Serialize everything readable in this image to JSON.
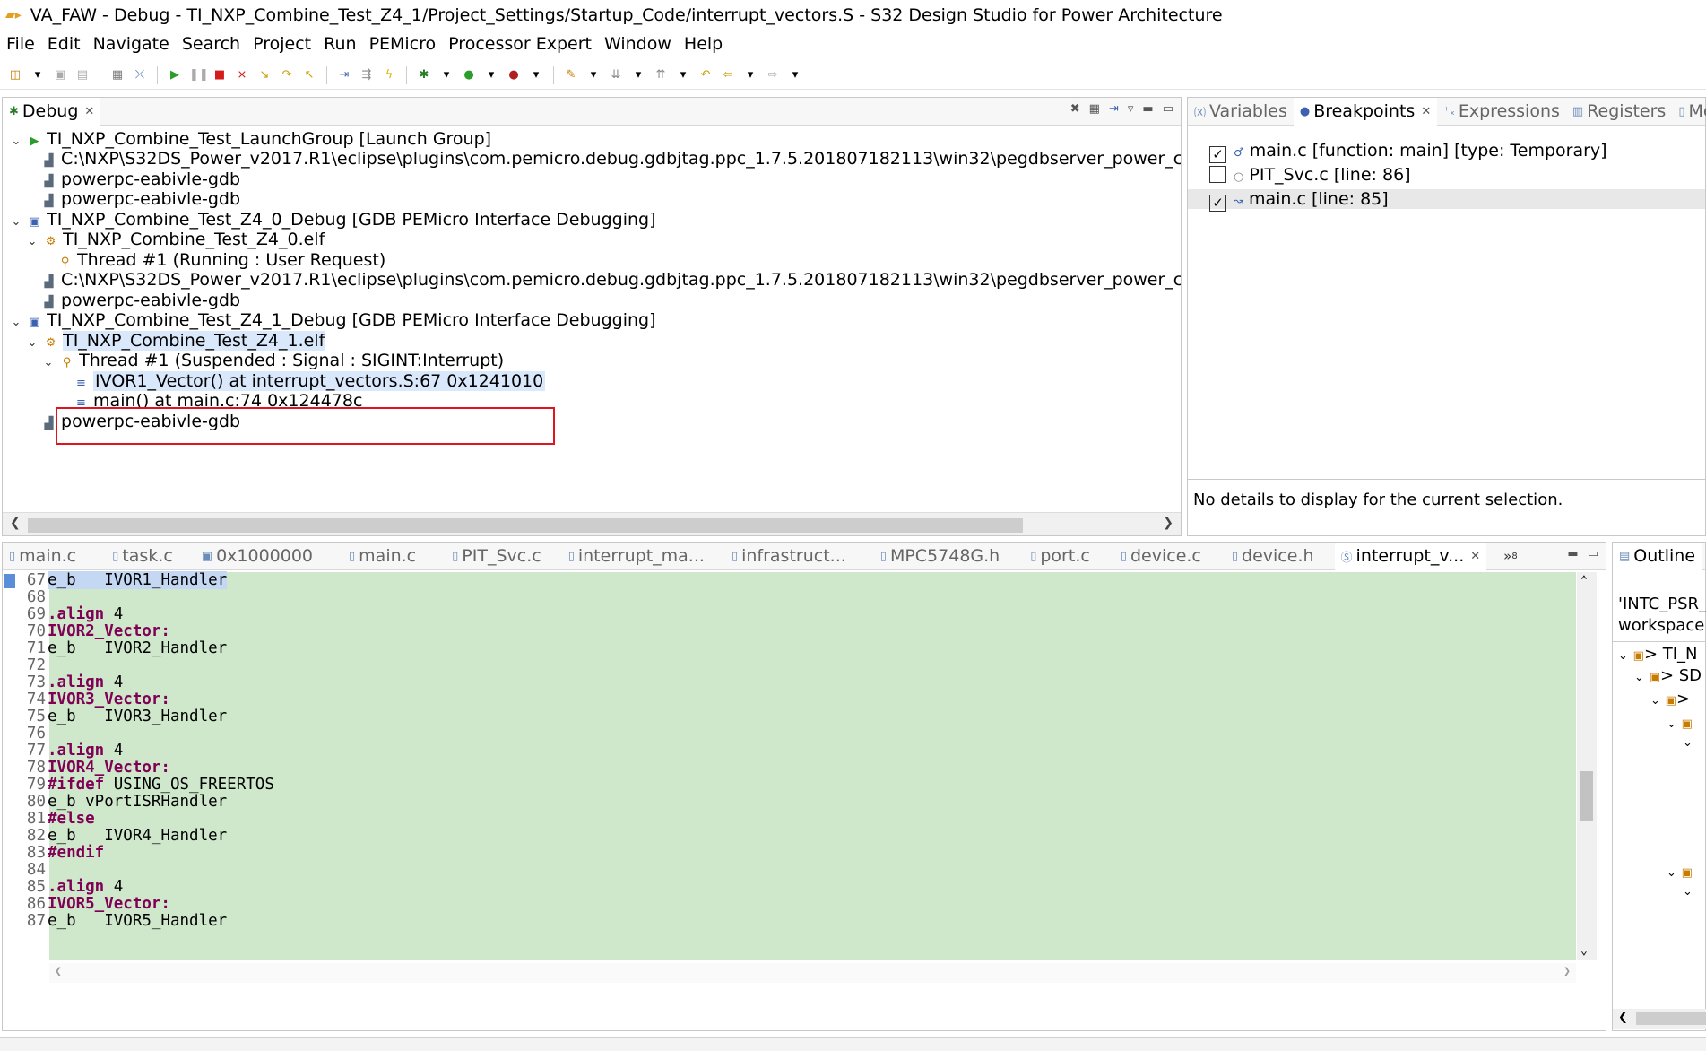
{
  "window": {
    "title": "VA_FAW - Debug - TI_NXP_Combine_Test_Z4_1/Project_Settings/Startup_Code/interrupt_vectors.S - S32 Design Studio for Power Architecture"
  },
  "menu": [
    "File",
    "Edit",
    "Navigate",
    "Search",
    "Project",
    "Run",
    "PEMicro",
    "Processor Expert",
    "Window",
    "Help"
  ],
  "debug_view": {
    "tab_label": "Debug",
    "rows": [
      "TI_NXP_Combine_Test_LaunchGroup [Launch Group]",
      "C:\\NXP\\S32DS_Power_v2017.R1\\eclipse\\plugins\\com.pemicro.debug.gdbjtag.ppc_1.7.5.201807182113\\win32\\pegdbserver_power_console",
      "powerpc-eabivle-gdb",
      "powerpc-eabivle-gdb",
      "TI_NXP_Combine_Test_Z4_0_Debug [GDB PEMicro Interface Debugging]",
      "TI_NXP_Combine_Test_Z4_0.elf",
      "Thread #1 (Running : User Request)",
      "C:\\NXP\\S32DS_Power_v2017.R1\\eclipse\\plugins\\com.pemicro.debug.gdbjtag.ppc_1.7.5.201807182113\\win32\\pegdbserver_power_console",
      "powerpc-eabivle-gdb",
      "TI_NXP_Combine_Test_Z4_1_Debug [GDB PEMicro Interface Debugging]",
      "TI_NXP_Combine_Test_Z4_1.elf",
      "Thread #1 (Suspended : Signal : SIGINT:Interrupt)",
      "IVOR1_Vector() at interrupt_vectors.S:67 0x1241010",
      "main() at main.c:74 0x124478c",
      "powerpc-eabivle-gdb"
    ]
  },
  "right_panel": {
    "tabs": [
      "Variables",
      "Breakpoints",
      "Expressions",
      "Registers",
      "Memo"
    ],
    "breakpoints": [
      {
        "label": "main.c [function: main] [type: Temporary]",
        "checked": "✓"
      },
      {
        "label": "PIT_Svc.c [line: 86]",
        "checked": ""
      },
      {
        "label": "main.c [line: 85]",
        "checked": "✓"
      }
    ],
    "details": "No details to display for the current selection."
  },
  "editor": {
    "tabs": [
      "main.c",
      "task.c",
      "0x1000000",
      "main.c",
      "PIT_Svc.c",
      "interrupt_ma...",
      "infrastruct...",
      "MPC5748G.h",
      "port.c",
      "device.c",
      "device.h",
      "interrupt_v..."
    ],
    "overflow": "»",
    "overflow_count": "8",
    "lines": [
      {
        "n": "67",
        "kw": "",
        "rest": "e_b   IVOR1_Handler"
      },
      {
        "n": "68",
        "kw": "",
        "rest": ""
      },
      {
        "n": "69",
        "kw": ".align",
        "rest": " 4"
      },
      {
        "n": "70",
        "kw": "IVOR2_Vector:",
        "rest": ""
      },
      {
        "n": "71",
        "kw": "",
        "rest": "e_b   IVOR2_Handler"
      },
      {
        "n": "72",
        "kw": "",
        "rest": ""
      },
      {
        "n": "73",
        "kw": ".align",
        "rest": " 4"
      },
      {
        "n": "74",
        "kw": "IVOR3_Vector:",
        "rest": ""
      },
      {
        "n": "75",
        "kw": "",
        "rest": "e_b   IVOR3_Handler"
      },
      {
        "n": "76",
        "kw": "",
        "rest": ""
      },
      {
        "n": "77",
        "kw": ".align",
        "rest": " 4"
      },
      {
        "n": "78",
        "kw": "IVOR4_Vector:",
        "rest": ""
      },
      {
        "n": "79",
        "kw": "#ifdef",
        "rest": " USING_OS_FREERTOS"
      },
      {
        "n": "80",
        "kw": "",
        "rest": "e_b vPortISRHandler"
      },
      {
        "n": "81",
        "kw": "#else",
        "rest": ""
      },
      {
        "n": "82",
        "kw": "",
        "rest": "e_b   IVOR4_Handler"
      },
      {
        "n": "83",
        "kw": "#endif",
        "rest": ""
      },
      {
        "n": "84",
        "kw": "",
        "rest": ""
      },
      {
        "n": "85",
        "kw": ".align",
        "rest": " 4"
      },
      {
        "n": "86",
        "kw": "IVOR5_Vector:",
        "rest": ""
      },
      {
        "n": "87",
        "kw": "",
        "rest": "e_b   IVOR5_Handler"
      }
    ]
  },
  "outline": {
    "tab_label": "Outline",
    "line1": "'INTC_PSR_",
    "line2": "workspace",
    "items": [
      "TI_N",
      "SD"
    ]
  },
  "colors": {
    "highlight": "#d9e8fa",
    "code_bg": "#cfe8cc",
    "keyword": "#7f0055",
    "annotation": "#e0141e"
  }
}
